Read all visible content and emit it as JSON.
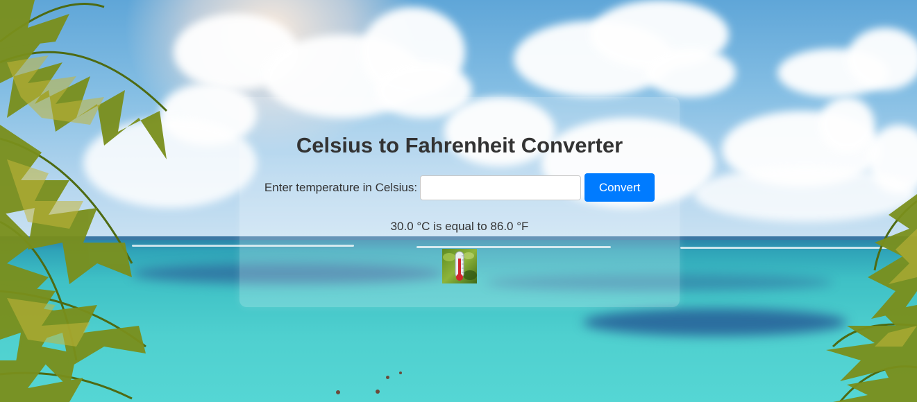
{
  "page": {
    "title": "Celsius to Fahrenheit Converter"
  },
  "form": {
    "label": "Enter temperature in Celsius:",
    "input_value": "",
    "input_placeholder": "",
    "button_label": "Convert"
  },
  "result": {
    "text": "30.0 °C is equal to 86.0 °F"
  },
  "icons": {
    "thermometer": "thermometer-icon"
  },
  "colors": {
    "accent": "#007bff",
    "text": "#333333"
  }
}
